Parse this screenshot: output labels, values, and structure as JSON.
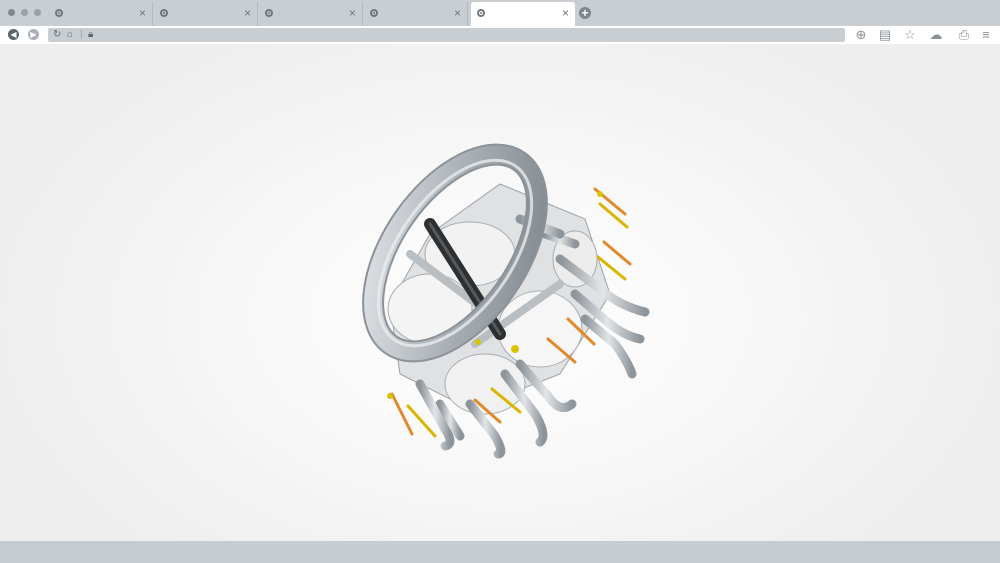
{
  "browser": {
    "tabs": [
      {
        "title": "",
        "close": "×"
      },
      {
        "title": "",
        "close": "×"
      },
      {
        "title": "",
        "close": "×"
      },
      {
        "title": "",
        "close": "×"
      },
      {
        "title": "",
        "close": "×",
        "active": true
      }
    ],
    "new_tab": "+",
    "address": {
      "url": ""
    },
    "toolbar_icons": [
      "zoom-icon",
      "archive-icon",
      "star-icon",
      "cloud-download-icon",
      "print-icon",
      "menu-icon"
    ]
  },
  "colors": {
    "chrome": "#c9ced3",
    "metal": "#b9bec3",
    "accent_orange": "#e08a2c",
    "accent_yellow": "#d9b400"
  }
}
